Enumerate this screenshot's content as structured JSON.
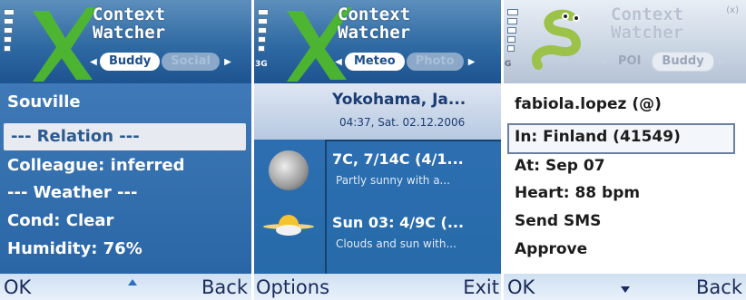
{
  "app": {
    "title_line1": "Context",
    "title_line2": "Watcher"
  },
  "screens": [
    {
      "tabs": {
        "active": "Buddy",
        "next": "Social"
      },
      "rows": [
        "Souville",
        "--- Relation ---",
        "Colleague: inferred",
        "--- Weather ---",
        "Cond: Clear",
        "Humidity: 76%"
      ],
      "softkeys": {
        "left": "OK",
        "right": "Back"
      }
    },
    {
      "network": "3G",
      "tabs": {
        "active": "Meteo",
        "next": "Photo"
      },
      "city": "Yokohama, Ja...",
      "datetime": "04:37, Sat. 02.12.2006",
      "forecast": [
        {
          "temps": "7C, 7/14C (4/1...",
          "desc": "Partly sunny with a..."
        },
        {
          "temps": "Sun 03: 4/9C (...",
          "desc": "Clouds and sun with..."
        }
      ],
      "softkeys": {
        "left": "Options",
        "right": "Exit"
      }
    },
    {
      "network": "G",
      "tabs": {
        "prev": "POI",
        "active": "Buddy"
      },
      "indicator": "(x)",
      "rows": [
        "fabiola.lopez (@)",
        "In: Finland (41549)",
        "At: Sep 07",
        "Heart: 88 bpm",
        "Send SMS",
        "Approve"
      ],
      "softkeys": {
        "left": "OK",
        "right": "Back"
      }
    }
  ],
  "colors": {
    "brand_green": "#4fb82c",
    "title_blue": "#2f6aa3",
    "selection": "#e7eaf0"
  }
}
